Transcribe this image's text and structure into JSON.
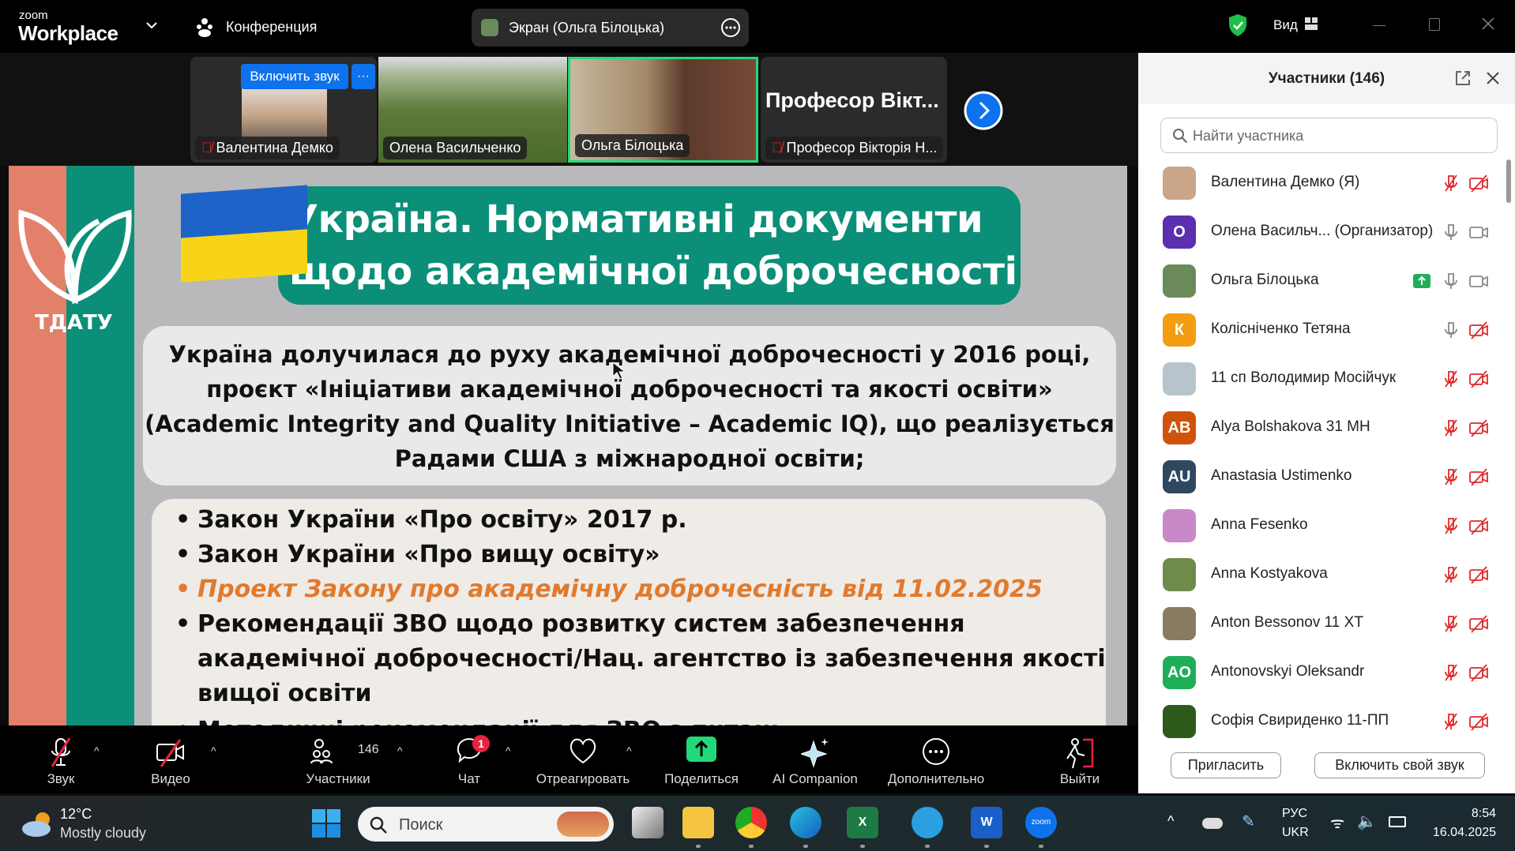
{
  "app": {
    "logo_top": "zoom",
    "logo_bottom": "Workplace",
    "meeting_label": "Конференция",
    "share_label": "Экран (Ольга Білоцька)",
    "view_label": "Вид"
  },
  "thumbnails": [
    {
      "name": "Валентина Демко",
      "muted": true,
      "unmute_button": "Включить звук",
      "more": "···"
    },
    {
      "name": "Олена Васильченко",
      "muted": false
    },
    {
      "name": "Ольга Білоцька",
      "muted": false,
      "active": true
    },
    {
      "name": "Професор Вікторія Н...",
      "big_label": "Професор  Вікт...",
      "muted": true
    }
  ],
  "slide": {
    "logo_text": "ТДАТУ",
    "title_line1": "Україна. Нормативні документи",
    "title_line2": "щодо академічної доброчесності",
    "intro": [
      "Україна долучилася до  руху академічної доброчесності у 2016 році,",
      "проєкт «Ініціативи академічної доброчесності та якості освіти»",
      "(Academic Integrity and Quality Initiative – Academic IQ), що реалізується",
      "Радами США з міжнародної освіти;"
    ],
    "bullets": [
      "Закон України «Про освіту» 2017 р.",
      "Закон України «Про вищу освіту»",
      "Проект Закону про академічну доброчесність від 11.02.2025",
      "Рекомендації ЗВО щодо розвитку систем забезпечення",
      "академічної доброчесності/Нац. агентство із забезпечення якості",
      "вищої освіти",
      "Методичні рекомендації для ЗВО з питань ..."
    ]
  },
  "panel": {
    "title": "Участники (146)",
    "search_placeholder": "Найти участника",
    "participants": [
      {
        "name": "Валентина Демко (Я)",
        "initials": "",
        "color": "#c9a58a",
        "mic": "muted",
        "cam": "off"
      },
      {
        "name": "Олена Васильч... (Организатор)",
        "initials": "О",
        "color": "#5a2fb0",
        "mic": "on",
        "cam": "on"
      },
      {
        "name": "Ольга Білоцька",
        "initials": "",
        "color": "#6b8a5a",
        "mic": "on",
        "cam": "on",
        "sharing": true
      },
      {
        "name": "Колісніченко Тетяна",
        "initials": "К",
        "color": "#f29d12",
        "mic": "on",
        "cam": "off"
      },
      {
        "name": "11 сп Володимир Мосійчук",
        "initials": "",
        "color": "#b8c4cc",
        "mic": "muted",
        "cam": "off"
      },
      {
        "name": "Alya Bolshakova 31 МН",
        "initials": "AB",
        "color": "#d0530c",
        "mic": "muted",
        "cam": "off"
      },
      {
        "name": "Anastasia Ustimenko",
        "initials": "AU",
        "color": "#2f475f",
        "mic": "muted",
        "cam": "off"
      },
      {
        "name": "Anna Fesenko",
        "initials": "",
        "color": "#c889c8",
        "mic": "muted",
        "cam": "off"
      },
      {
        "name": "Anna Kostyakova",
        "initials": "",
        "color": "#6f8a4a",
        "mic": "muted",
        "cam": "off"
      },
      {
        "name": "Anton Bessonov 11 ХТ",
        "initials": "",
        "color": "#8a7a60",
        "mic": "muted",
        "cam": "off"
      },
      {
        "name": "Antonovskyi Oleksandr",
        "initials": "AO",
        "color": "#1fae58",
        "mic": "muted",
        "cam": "off"
      },
      {
        "name": "Софія Свириденко 11-ПП",
        "initials": "",
        "color": "#2d5a1a",
        "mic": "muted",
        "cam": "off"
      }
    ],
    "invite_button": "Пригласить",
    "unmute_self_button": "Включить свой звук"
  },
  "toolbar": {
    "audio": "Звук",
    "video": "Видео",
    "participants": "Участники",
    "participants_count": "146",
    "chat": "Чат",
    "chat_badge": "1",
    "react": "Отреагировать",
    "share": "Поделиться",
    "ai": "AI Companion",
    "more": "Дополнительно",
    "leave": "Выйти"
  },
  "taskbar": {
    "temp": "12°C",
    "weather": "Mostly cloudy",
    "search_placeholder": "Поиск",
    "lang1": "РУС",
    "lang2": "UKR",
    "time": "8:54",
    "date": "16.04.2025"
  },
  "colors": {
    "accent": "#0e72ed",
    "teal": "#0b8f78",
    "orange": "#e07a2e",
    "muted_red": "#e02828"
  }
}
